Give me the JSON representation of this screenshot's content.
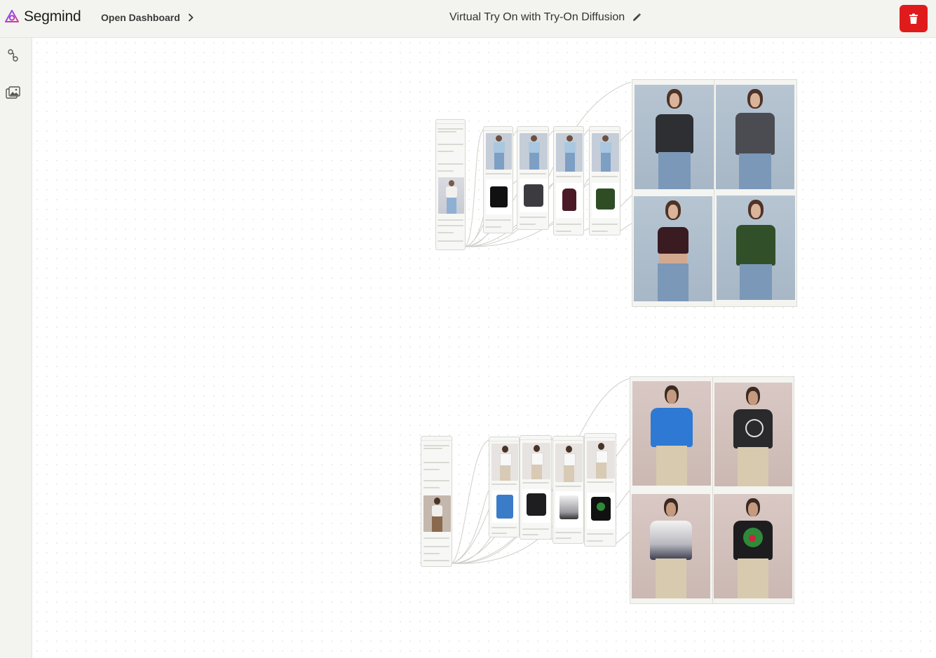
{
  "header": {
    "brand": "Segmind",
    "breadcrumb_label": "Open Dashboard",
    "title": "Virtual Try On with Try-On Diffusion"
  },
  "sidebar": {
    "items": [
      {
        "name": "workflow-icon"
      },
      {
        "name": "gallery-icon"
      }
    ]
  },
  "colors": {
    "accent": "#e01b1b",
    "brand": "#c83cb3",
    "bg": "#f3f3ef"
  }
}
